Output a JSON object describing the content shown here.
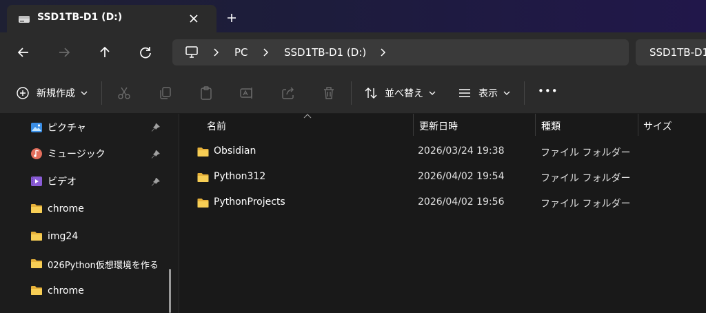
{
  "tab": {
    "title": "SSD1TB-D1 (D:)"
  },
  "address": {
    "crumbs": [
      "PC",
      "SSD1TB-D1 (D:)"
    ]
  },
  "search": {
    "text": "SSD1TB-D1"
  },
  "commands": {
    "new": "新規作成",
    "sort": "並べ替え",
    "view": "表示",
    "more": "•••"
  },
  "sidebar": {
    "items": [
      {
        "label": "ピクチャ",
        "icon": "pictures-icon",
        "pinned": true
      },
      {
        "label": "ミュージック",
        "icon": "music-icon",
        "pinned": true
      },
      {
        "label": "ビデオ",
        "icon": "video-icon",
        "pinned": true
      },
      {
        "label": "chrome",
        "icon": "folder-icon",
        "pinned": false
      },
      {
        "label": "img24",
        "icon": "folder-icon",
        "pinned": false
      },
      {
        "label": "026Python仮想環境を作る",
        "icon": "folder-icon",
        "pinned": false
      },
      {
        "label": "chrome",
        "icon": "folder-icon",
        "pinned": false
      }
    ]
  },
  "columns": {
    "name": "名前",
    "date": "更新日時",
    "type": "種類",
    "size": "サイズ"
  },
  "files": [
    {
      "name": "Obsidian",
      "date": "2026/03/24 19:38",
      "type": "ファイル フォルダー"
    },
    {
      "name": "Python312",
      "date": "2026/04/02 19:54",
      "type": "ファイル フォルダー"
    },
    {
      "name": "PythonProjects",
      "date": "2026/04/02 19:56",
      "type": "ファイル フォルダー"
    }
  ],
  "colors": {
    "folder": "#f4c542",
    "accent": "#4cc2ff"
  }
}
